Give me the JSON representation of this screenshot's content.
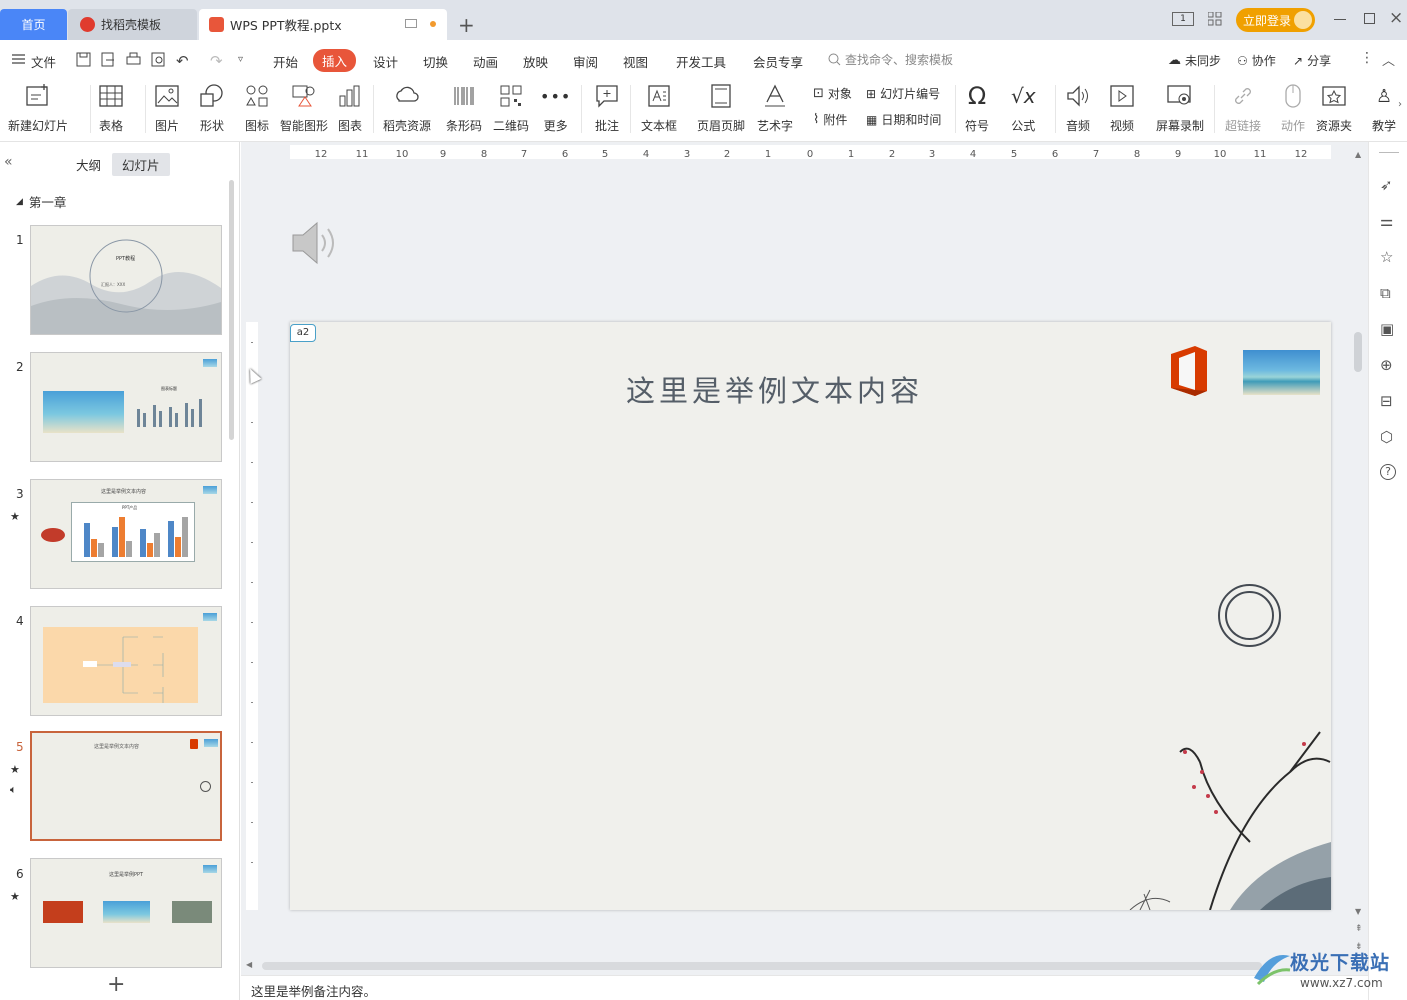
{
  "tabs": {
    "home": "首页",
    "template": "找稻壳模板",
    "doc": "WPS PPT教程.pptx"
  },
  "titlebar": {
    "login": "立即登录"
  },
  "menu": {
    "file": "文件",
    "items": [
      "开始",
      "插入",
      "设计",
      "切换",
      "动画",
      "放映",
      "审阅",
      "视图",
      "开发工具",
      "会员专享"
    ],
    "search_placeholder": "查找命令、搜索模板",
    "sync": "未同步",
    "collab": "协作",
    "share": "分享"
  },
  "ribbon": {
    "new_slide": "新建幻灯片",
    "table": "表格",
    "picture": "图片",
    "shape": "形状",
    "icon": "图标",
    "smart_shape": "智能图形",
    "chart": "图表",
    "daoke_res": "稻壳资源",
    "barcode": "条形码",
    "qrcode": "二维码",
    "more": "更多",
    "comment": "批注",
    "textbox": "文本框",
    "header_footer": "页眉页脚",
    "wordart": "艺术字",
    "object": "对象",
    "slide_number": "幻灯片编号",
    "attachment": "附件",
    "datetime": "日期和时间",
    "symbol": "符号",
    "formula": "公式",
    "audio": "音频",
    "video": "视频",
    "screen_record": "屏幕录制",
    "hyperlink": "超链接",
    "action": "动作",
    "resource": "资源夹",
    "teach": "教学"
  },
  "panel": {
    "outline_tab": "大纲",
    "slides_tab": "幻灯片",
    "section": "第一章",
    "slide_numbers": [
      "1",
      "2",
      "3",
      "4",
      "5",
      "6"
    ],
    "thumb1_title": "PPT教程",
    "thumb1_sub": "汇报人：XXX",
    "thumb2_title": "图表标题",
    "thumb3_title": "这里是举例文本内容",
    "thumb3_chart": "PPT产品",
    "thumb5_title": "这里是举例文本内容",
    "thumb6_title": "这里是举例PPT"
  },
  "slide": {
    "comment_tag": "a2",
    "title": "这里是举例文本内容"
  },
  "status": {
    "notes": "这里是举例备注内容。"
  },
  "watermark": {
    "text": "极光下载站",
    "url": "www.xz7.com"
  },
  "colors": {
    "accent": "#e8563a",
    "home_tab": "#4a86f7",
    "login": "#f0a000",
    "selected_border": "#c8643c"
  }
}
